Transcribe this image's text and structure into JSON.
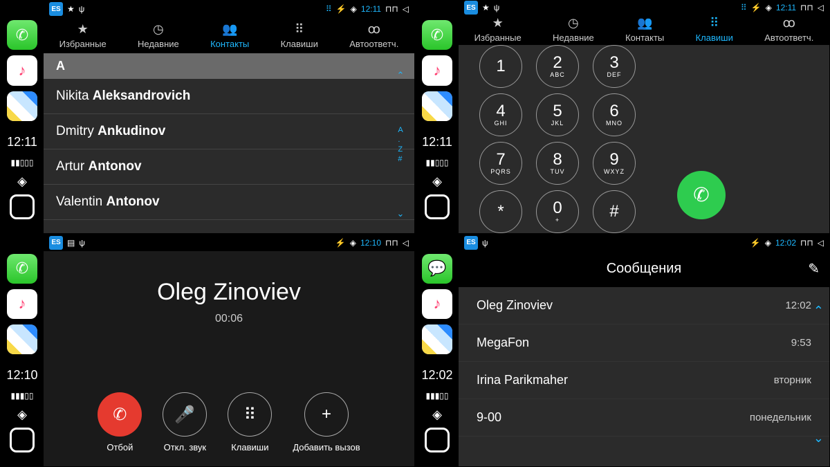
{
  "q1": {
    "status_time": "12:11",
    "sidebar_time": "12:11",
    "tabs": [
      "Избранные",
      "Недавние",
      "Контакты",
      "Клавиши",
      "Автоответч."
    ],
    "active_tab": 2,
    "section": "A",
    "contacts": [
      {
        "first": "Nikita",
        "last": "Aleksandrovich"
      },
      {
        "first": "Dmitry",
        "last": "Ankudinov"
      },
      {
        "first": "Artur",
        "last": "Antonov"
      },
      {
        "first": "Valentin",
        "last": "Antonov"
      }
    ],
    "index": [
      "A",
      ".",
      "Z",
      "#"
    ]
  },
  "q2": {
    "status_time": "12:11",
    "sidebar_time": "12:11",
    "tabs": [
      "Избранные",
      "Недавние",
      "Контакты",
      "Клавиши",
      "Автоответч."
    ],
    "active_tab": 3,
    "keys": [
      {
        "n": "1",
        "s": ""
      },
      {
        "n": "2",
        "s": "ABC"
      },
      {
        "n": "3",
        "s": "DEF"
      },
      {
        "n": "4",
        "s": "GHI"
      },
      {
        "n": "5",
        "s": "JKL"
      },
      {
        "n": "6",
        "s": "MNO"
      },
      {
        "n": "7",
        "s": "PQRS"
      },
      {
        "n": "8",
        "s": "TUV"
      },
      {
        "n": "9",
        "s": "WXYZ"
      },
      {
        "n": "*",
        "s": ""
      },
      {
        "n": "0",
        "s": "+"
      },
      {
        "n": "#",
        "s": ""
      }
    ]
  },
  "q3": {
    "status_time": "12:10",
    "sidebar_time": "12:10",
    "name": "Oleg Zinoviev",
    "duration": "00:06",
    "actions": [
      "Отбой",
      "Откл. звук",
      "Клавиши",
      "Добавить вызов"
    ]
  },
  "q4": {
    "status_time": "12:02",
    "sidebar_time": "12:02",
    "title": "Сообщения",
    "messages": [
      {
        "name": "Oleg Zinoviev",
        "time": "12:02"
      },
      {
        "name": "MegaFon",
        "time": "9:53"
      },
      {
        "name": "Irina Parikmaher",
        "time": "вторник"
      },
      {
        "name": "9-00",
        "time": "понедельник"
      }
    ]
  }
}
